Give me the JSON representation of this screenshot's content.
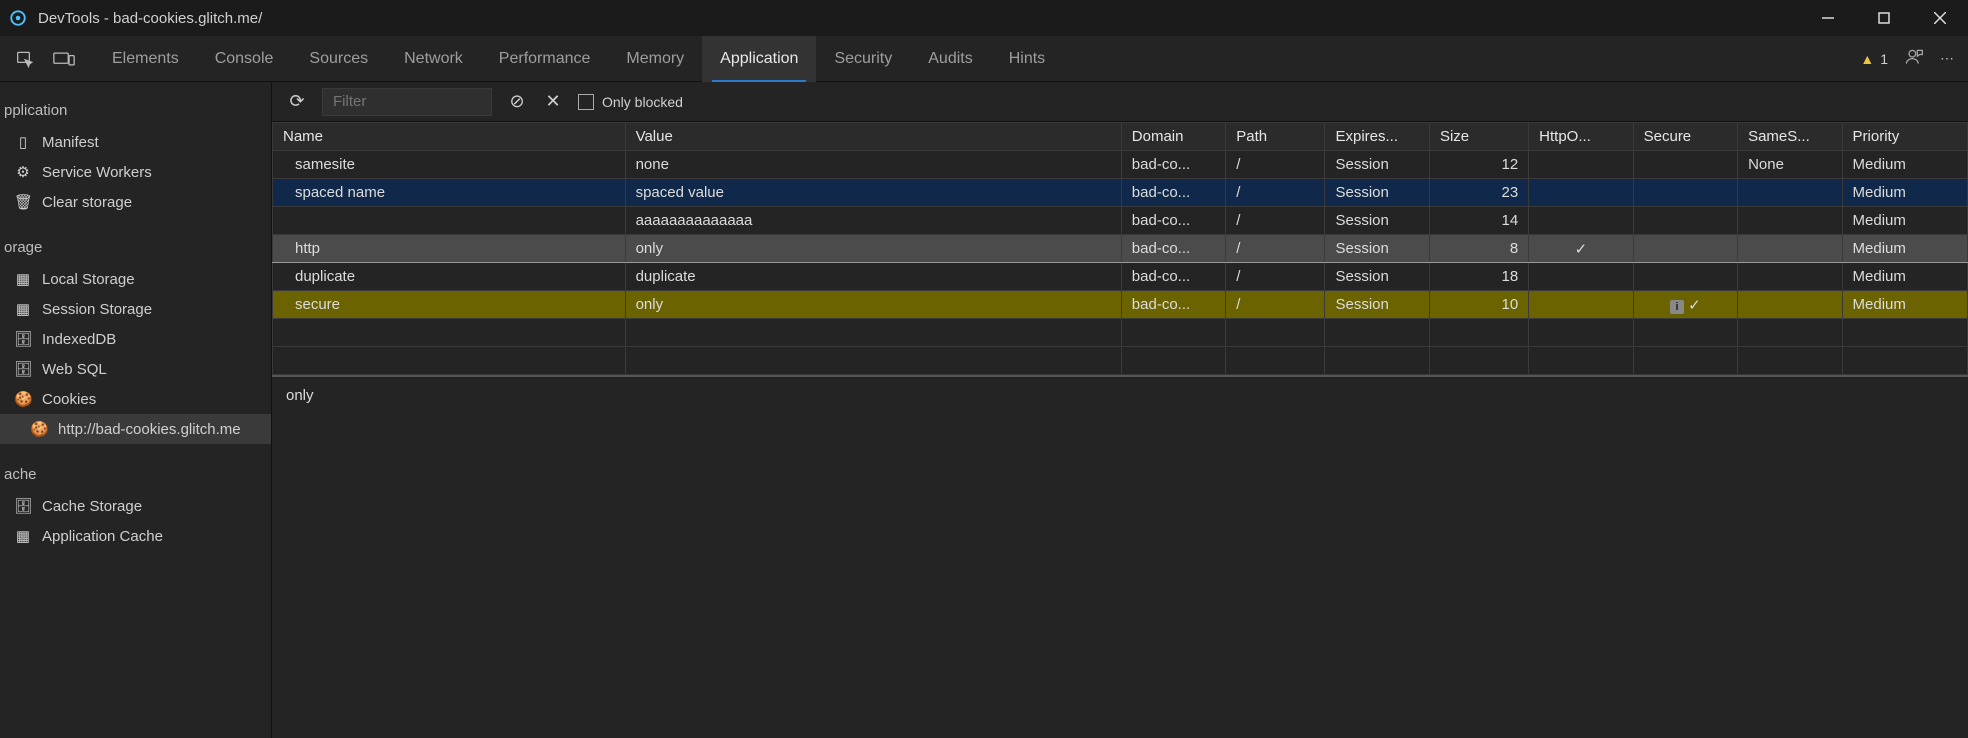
{
  "window": {
    "title": "DevTools - bad-cookies.glitch.me/"
  },
  "tabs": {
    "items": [
      "Elements",
      "Console",
      "Sources",
      "Network",
      "Performance",
      "Memory",
      "Application",
      "Security",
      "Audits",
      "Hints"
    ],
    "active": "Application",
    "warn_count": "1"
  },
  "sidebar": {
    "sections": {
      "application": {
        "label": "pplication",
        "items": [
          "Manifest",
          "Service Workers",
          "Clear storage"
        ]
      },
      "storage": {
        "label": "orage",
        "items": [
          "Local Storage",
          "Session Storage",
          "IndexedDB",
          "Web SQL",
          "Cookies"
        ],
        "cookie_child": "http://bad-cookies.glitch.me"
      },
      "cache": {
        "label": "ache",
        "items": [
          "Cache Storage",
          "Application Cache"
        ]
      }
    }
  },
  "toolbar": {
    "filter_placeholder": "Filter",
    "only_blocked_label": "Only blocked"
  },
  "table": {
    "headers": [
      "Name",
      "Value",
      "Domain",
      "Path",
      "Expires...",
      "Size",
      "HttpO...",
      "Secure",
      "SameS...",
      "Priority"
    ],
    "rows": [
      {
        "name": "samesite",
        "value": "none",
        "domain": "bad-co...",
        "path": "/",
        "expires": "Session",
        "size": "12",
        "httponly": "",
        "secure": "",
        "samesite": "None",
        "priority": "Medium",
        "style": "dark"
      },
      {
        "name": "spaced name",
        "value": "spaced value",
        "domain": "bad-co...",
        "path": "/",
        "expires": "Session",
        "size": "23",
        "httponly": "",
        "secure": "",
        "samesite": "",
        "priority": "Medium",
        "style": "blue"
      },
      {
        "name": "",
        "value": "aaaaaaaaaaaaaa",
        "domain": "bad-co...",
        "path": "/",
        "expires": "Session",
        "size": "14",
        "httponly": "",
        "secure": "",
        "samesite": "",
        "priority": "Medium",
        "style": "dark"
      },
      {
        "name": "http",
        "value": "only",
        "domain": "bad-co...",
        "path": "/",
        "expires": "Session",
        "size": "8",
        "httponly": "✓",
        "secure": "",
        "samesite": "",
        "priority": "Medium",
        "style": "grey"
      },
      {
        "name": "duplicate",
        "value": "duplicate",
        "domain": "bad-co...",
        "path": "/",
        "expires": "Session",
        "size": "18",
        "httponly": "",
        "secure": "",
        "samesite": "",
        "priority": "Medium",
        "style": "dark"
      },
      {
        "name": "secure",
        "value": "only",
        "domain": "bad-co...",
        "path": "/",
        "expires": "Session",
        "size": "10",
        "httponly": "",
        "secure": "i✓",
        "samesite": "",
        "priority": "Medium",
        "style": "olive"
      }
    ]
  },
  "detail": {
    "value": "only"
  }
}
